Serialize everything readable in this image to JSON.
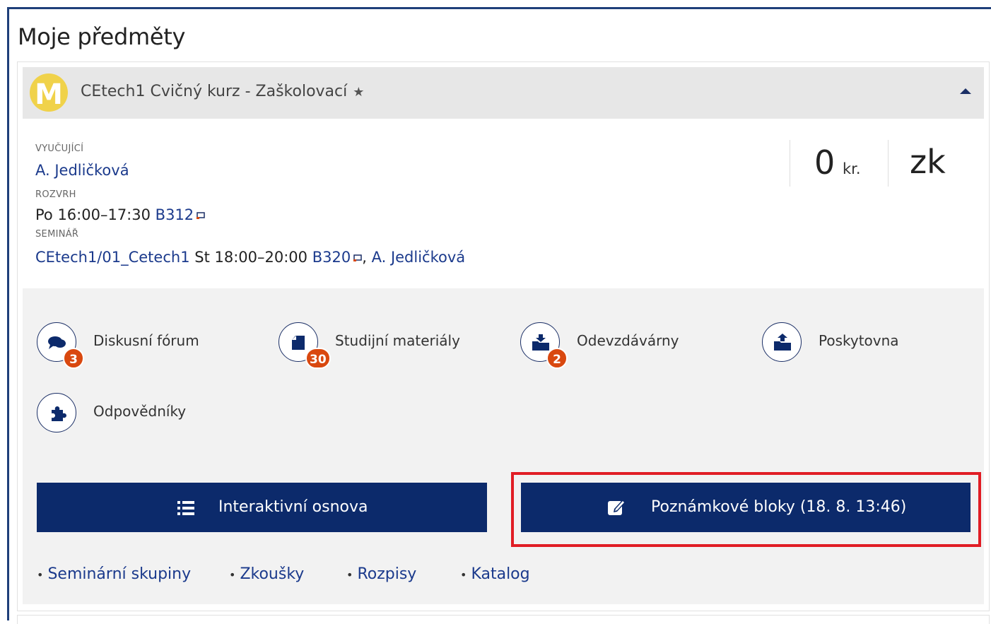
{
  "page": {
    "title": "Moje předměty"
  },
  "course": {
    "title": "CEtech1 Cvičný kurz - Zaškolovací",
    "favorite_icon": "star-icon",
    "collapse_icon": "chevron-up-icon",
    "logo_letter": "M",
    "logo_color": "#f0d24a"
  },
  "details": {
    "teacher_label": "VYUČUJÍCÍ",
    "teacher": "A. Jedličková",
    "schedule_label": "ROZVRH",
    "schedule_time": "Po 16:00–17:30",
    "schedule_room": "B312",
    "seminar_label": "SEMINÁŘ",
    "seminar_group": "CEtech1/01_Cetech1",
    "seminar_time": "St 18:00–20:00",
    "seminar_room": "B320",
    "seminar_sep": ",",
    "seminar_teacher": "A. Jedličková"
  },
  "credits": {
    "value": "0",
    "unit": "kr.",
    "completion": "zk"
  },
  "tools": [
    {
      "label": "Diskusní fórum",
      "badge": "3",
      "icon": "forum-chat-icon"
    },
    {
      "label": "Studijní materiály",
      "badge": "30",
      "icon": "document-icon"
    },
    {
      "label": "Odevzdávárny",
      "badge": "2",
      "icon": "folder-submit-icon"
    },
    {
      "label": "Poskytovna",
      "badge": "",
      "icon": "folder-share-icon"
    },
    {
      "label": "Odpovědníky",
      "badge": "",
      "icon": "puzzle-icon"
    }
  ],
  "buttons": {
    "syllabus": "Interaktivní osnova",
    "notebooks": "Poznámkové bloky (18. 8. 13:46)"
  },
  "bullet": "•",
  "links": [
    "Seminární skupiny",
    "Zkoušky",
    "Rozpisy",
    "Katalog"
  ],
  "colors": {
    "accent": "#0c2a6b",
    "badge": "#d9480f",
    "highlight": "#e11d25"
  }
}
